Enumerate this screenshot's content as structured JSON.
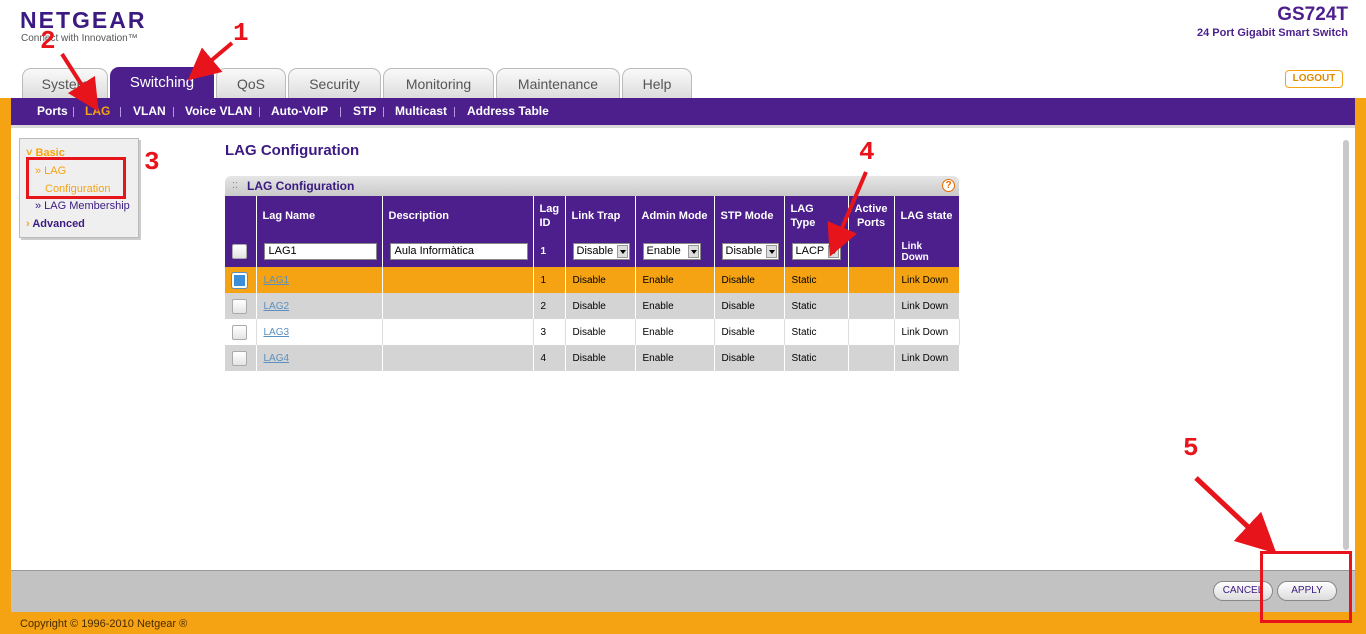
{
  "header": {
    "logo": "NETGEAR",
    "tagline": "Connect with Innovation™",
    "model": "GS724T",
    "model_desc": "24 Port Gigabit Smart Switch",
    "logout": "LOGOUT"
  },
  "tabs": [
    "System",
    "Switching",
    "QoS",
    "Security",
    "Monitoring",
    "Maintenance",
    "Help"
  ],
  "subnav": [
    "Ports",
    "LAG",
    "VLAN",
    "Voice VLAN",
    "Auto-VoIP",
    "STP",
    "Multicast",
    "Address Table"
  ],
  "sidebar": {
    "basic": "Basic",
    "lag_conf_1": "» LAG",
    "lag_conf_2": "Configuration",
    "lag_membership": "» LAG Membership",
    "advanced": "Advanced"
  },
  "page_title": "LAG Configuration",
  "panel_title": "LAG Configuration",
  "help_icon": "?",
  "table": {
    "headers": {
      "name": "Lag Name",
      "desc": "Description",
      "id_1": "Lag",
      "id_2": "ID",
      "trap": "Link Trap",
      "admin": "Admin Mode",
      "stp": "STP Mode",
      "type": "LAG Type",
      "active_1": "Active",
      "active_2": "Ports",
      "state": "LAG state"
    },
    "edit_row": {
      "name": "LAG1",
      "desc": "Aula Informàtica",
      "id": "1",
      "trap": "Disable",
      "admin": "Enable",
      "stp": "Disable",
      "type": "LACP",
      "active": "",
      "state": "Link Down"
    },
    "rows": [
      {
        "name": "LAG1",
        "desc": "",
        "id": "1",
        "trap": "Disable",
        "admin": "Enable",
        "stp": "Disable",
        "type": "Static",
        "active": "",
        "state": "Link Down"
      },
      {
        "name": "LAG2",
        "desc": "",
        "id": "2",
        "trap": "Disable",
        "admin": "Enable",
        "stp": "Disable",
        "type": "Static",
        "active": "",
        "state": "Link Down"
      },
      {
        "name": "LAG3",
        "desc": "",
        "id": "3",
        "trap": "Disable",
        "admin": "Enable",
        "stp": "Disable",
        "type": "Static",
        "active": "",
        "state": "Link Down"
      },
      {
        "name": "LAG4",
        "desc": "",
        "id": "4",
        "trap": "Disable",
        "admin": "Enable",
        "stp": "Disable",
        "type": "Static",
        "active": "",
        "state": "Link Down"
      }
    ]
  },
  "buttons": {
    "cancel": "CANCEL",
    "apply": "APPLY"
  },
  "copyright": "Copyright © 1996-2010 Netgear ®",
  "annotations": [
    "1",
    "2",
    "3",
    "4",
    "5"
  ],
  "colors": {
    "brand_purple": "#4c1f8c",
    "accent_orange": "#f5a312",
    "annotation_red": "#e8141c"
  }
}
